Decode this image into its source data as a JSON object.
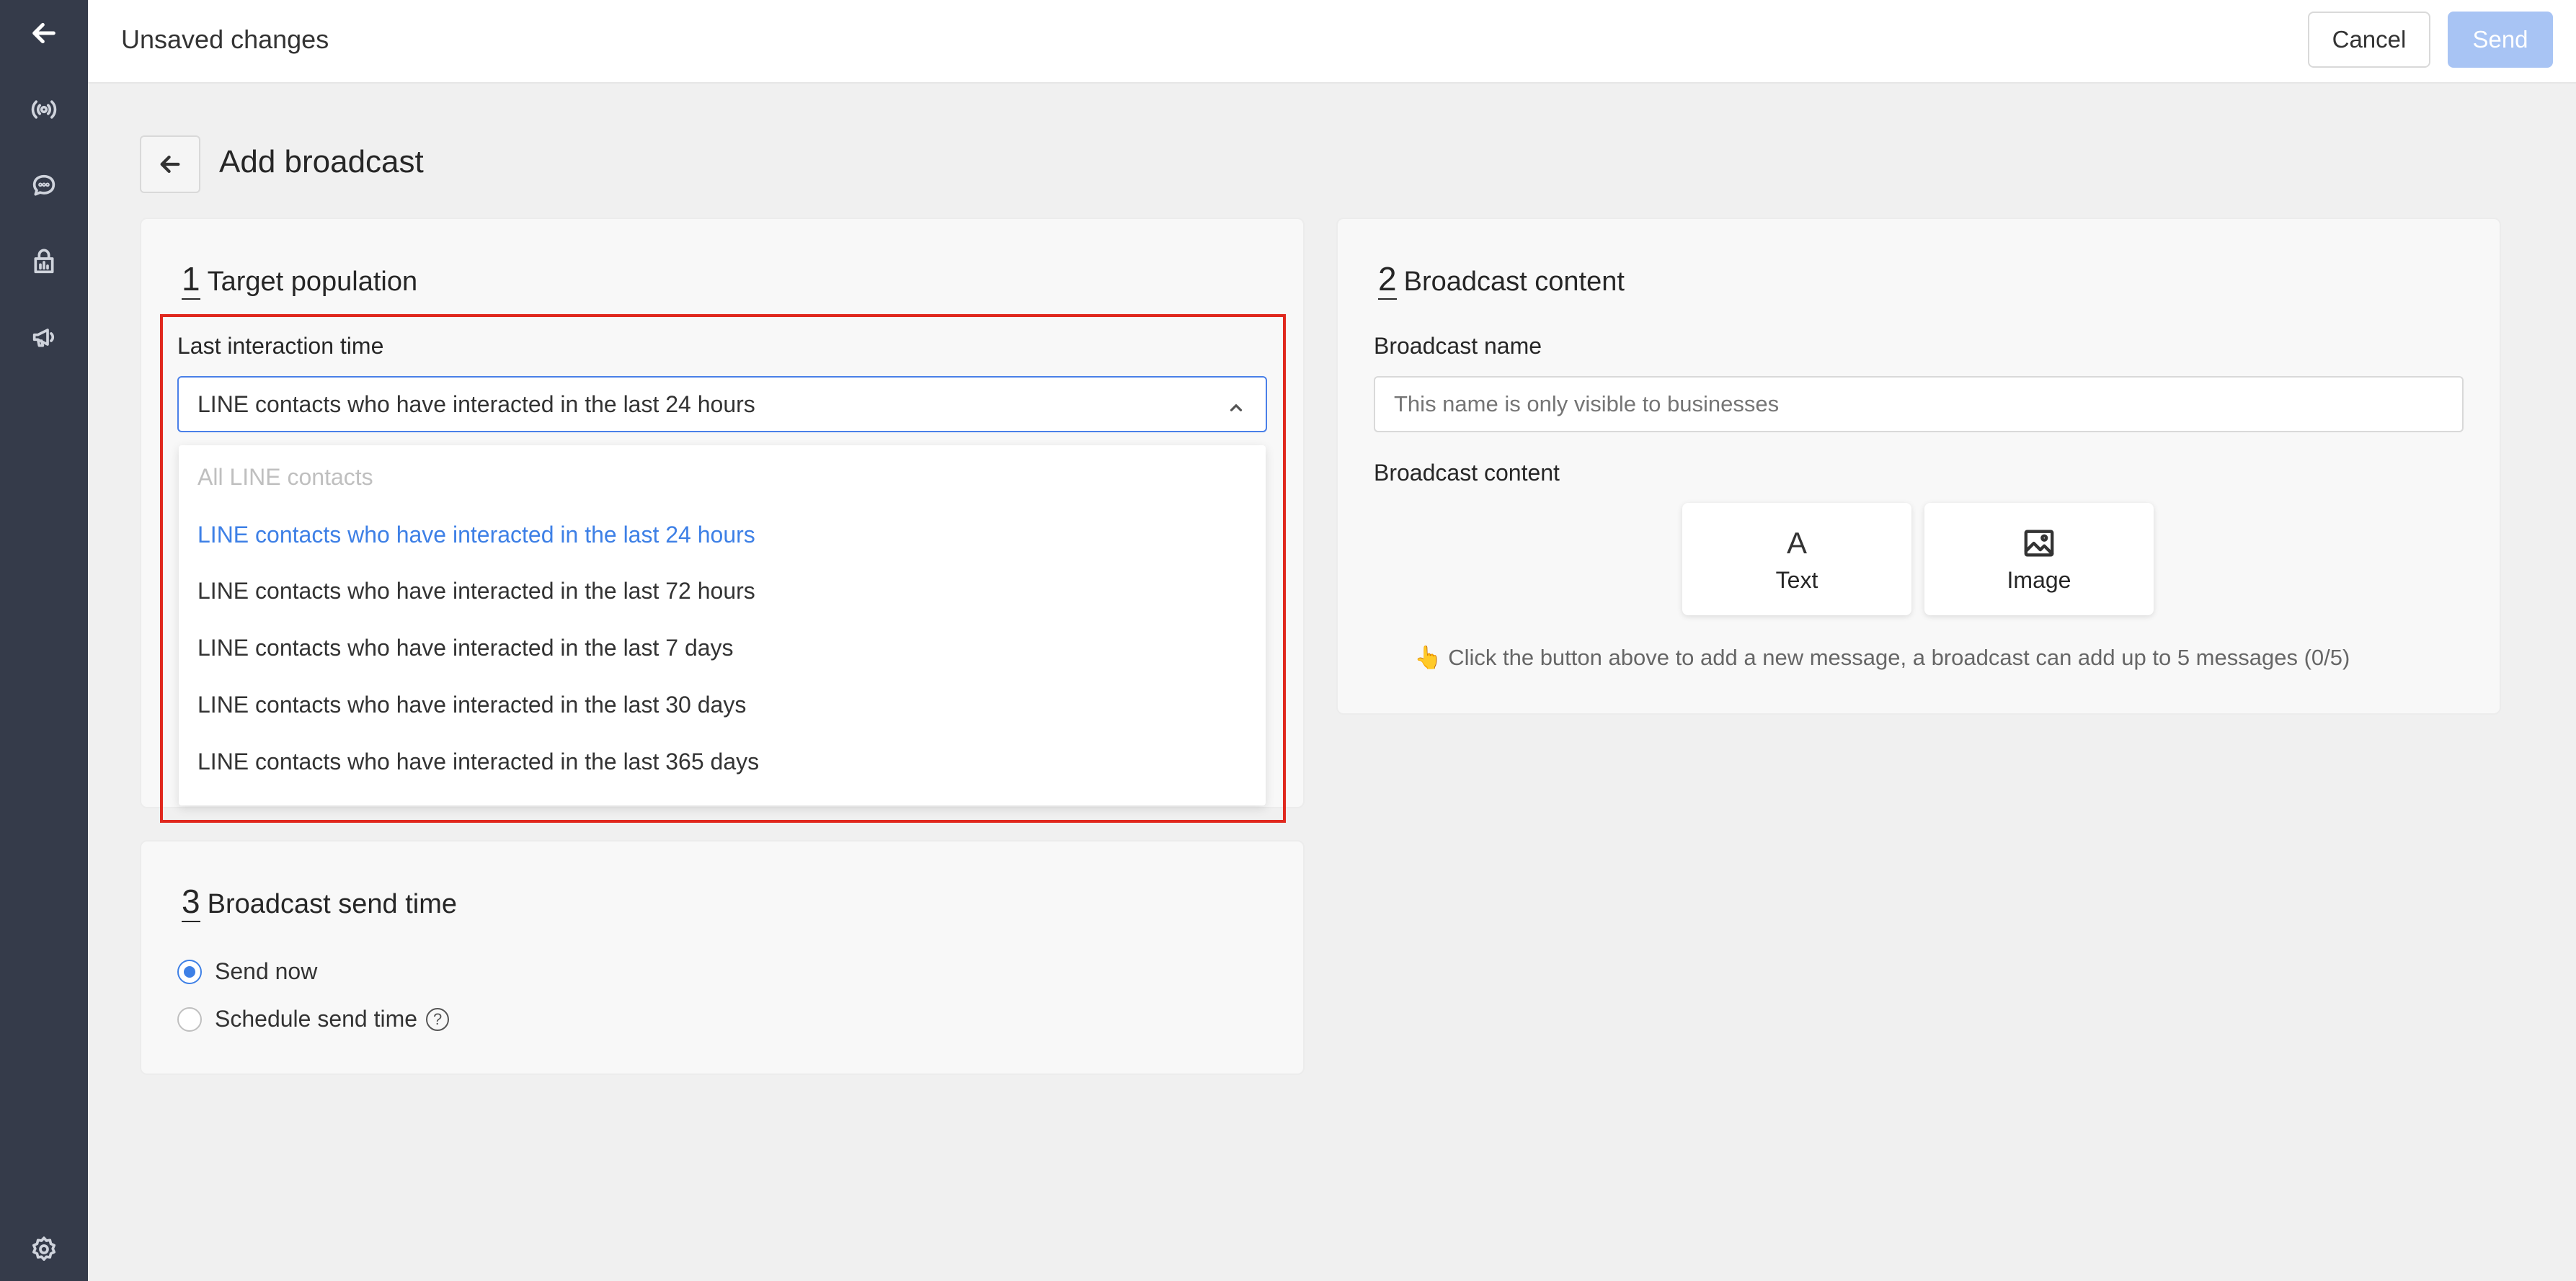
{
  "sidebar": {
    "icons": [
      "back-arrow-icon",
      "broadcast-icon",
      "chat-icon",
      "store-icon",
      "megaphone-icon",
      "gear-icon"
    ]
  },
  "topbar": {
    "title": "Unsaved changes",
    "cancel_label": "Cancel",
    "send_label": "Send"
  },
  "page": {
    "title": "Add broadcast"
  },
  "target": {
    "number": "1",
    "label": "Target population",
    "field_label": "Last interaction time",
    "selected_value": "LINE contacts who have interacted in the last 24 hours",
    "options": [
      "All LINE contacts",
      "LINE contacts who have interacted in the last 24 hours",
      "LINE contacts who have interacted in the last 72 hours",
      "LINE contacts who have interacted in the last 7 days",
      "LINE contacts who have interacted in the last 30 days",
      "LINE contacts who have interacted in the last 365 days"
    ]
  },
  "content": {
    "number": "2",
    "label": "Broadcast content",
    "name_label": "Broadcast name",
    "name_placeholder": "This name is only visible to businesses",
    "content_label": "Broadcast content",
    "text_tile": "Text",
    "text_glyph": "A",
    "image_tile": "Image",
    "hint": "👆 Click the button above to add a new message, a broadcast can add up to 5 messages  (0/5)"
  },
  "send_time": {
    "number": "3",
    "label": "Broadcast send time",
    "option_now": "Send now",
    "option_schedule": "Schedule send time",
    "help_glyph": "?"
  },
  "colors": {
    "accent": "#3e80e6",
    "sidebar": "#353b4a",
    "highlight": "#e0281e",
    "send_disabled": "#a8c4f4"
  }
}
